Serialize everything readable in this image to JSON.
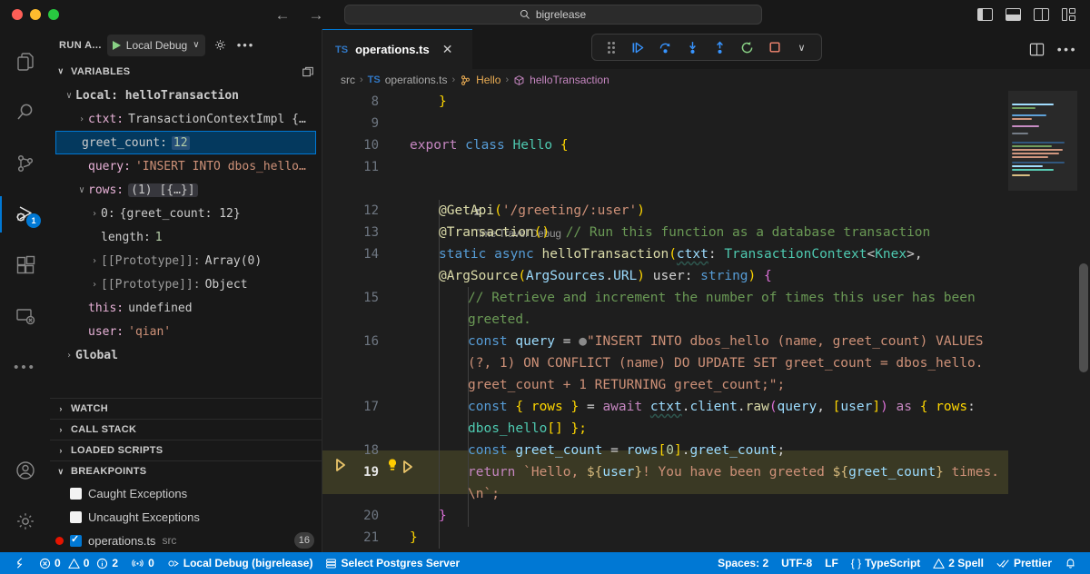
{
  "titlebar": {
    "search_value": "bigrelease",
    "search_icon": "search-icon",
    "back_icon": "←",
    "forward_icon": "→",
    "layout_icons": [
      "toggle-primary-sidebar",
      "toggle-panel",
      "toggle-secondary-sidebar",
      "customize-layout"
    ]
  },
  "activitybar": {
    "items": [
      {
        "name": "explorer",
        "icon": "files-icon",
        "active": false
      },
      {
        "name": "search",
        "icon": "search-icon",
        "active": false
      },
      {
        "name": "source-control",
        "icon": "source-control-icon",
        "active": false
      },
      {
        "name": "run-and-debug",
        "icon": "debug-icon",
        "active": true,
        "badge": "1"
      },
      {
        "name": "extensions",
        "icon": "extensions-icon",
        "active": false
      },
      {
        "name": "remote-explorer",
        "icon": "remote-icon",
        "active": false
      },
      {
        "name": "more",
        "icon": "ellipsis-icon",
        "active": false
      }
    ],
    "bottom": [
      {
        "name": "accounts",
        "icon": "account-icon"
      },
      {
        "name": "settings",
        "icon": "gear-icon"
      }
    ]
  },
  "sidebar": {
    "header": {
      "title": "RUN A...",
      "config_label": "Local Debug",
      "play_icon": "play-icon",
      "chevron_icon": "chevron-down-icon",
      "gear_icon": "gear-icon",
      "more_icon": "ellipsis-icon"
    },
    "variables": {
      "title": "VARIABLES",
      "action_icon": "split-view-icon",
      "rows": [
        {
          "indent": 0,
          "twisty": "∨",
          "name": "Local: helloTransaction",
          "value": "",
          "style": "scope"
        },
        {
          "indent": 1,
          "twisty": "›",
          "name": "ctxt:",
          "value": "TransactionContextImpl {…",
          "style": "plain"
        },
        {
          "indent": 2,
          "twisty": "",
          "name": "greet_count:",
          "value": "12",
          "style": "num",
          "selected": true
        },
        {
          "indent": 2,
          "twisty": "",
          "name": "query:",
          "value": "'INSERT INTO dbos_hello…",
          "style": "str"
        },
        {
          "indent": 1,
          "twisty": "∨",
          "name": "rows:",
          "value": "(1) [{…}]",
          "style": "chip"
        },
        {
          "indent": 2,
          "twisty": "›",
          "name": "0:",
          "value": "{greet_count: 12}",
          "style": "plain"
        },
        {
          "indent": 3,
          "twisty": "",
          "name": "length:",
          "value": "1",
          "style": "num"
        },
        {
          "indent": 2,
          "twisty": "›",
          "name": "[[Prototype]]:",
          "value": "Array(0)",
          "style": "dim"
        },
        {
          "indent": 2,
          "twisty": "›",
          "name": "[[Prototype]]:",
          "value": "Object",
          "style": "dim"
        },
        {
          "indent": 2,
          "twisty": "",
          "name": "this:",
          "value": "undefined",
          "style": "plain"
        },
        {
          "indent": 2,
          "twisty": "",
          "name": "user:",
          "value": "'qian'",
          "style": "str"
        },
        {
          "indent": 0,
          "twisty": "›",
          "name": "Global",
          "value": "",
          "style": "scope"
        }
      ]
    },
    "sections": [
      {
        "title": "WATCH",
        "twisty": "›"
      },
      {
        "title": "CALL STACK",
        "twisty": "›"
      },
      {
        "title": "LOADED SCRIPTS",
        "twisty": "›"
      }
    ],
    "breakpoints": {
      "title": "BREAKPOINTS",
      "twisty": "∨",
      "items": [
        {
          "label": "Caught Exceptions",
          "checked": false,
          "dot": false,
          "dir": "",
          "line": ""
        },
        {
          "label": "Uncaught Exceptions",
          "checked": false,
          "dot": false,
          "dir": "",
          "line": ""
        },
        {
          "label": "operations.ts",
          "checked": true,
          "dot": true,
          "dir": "src",
          "line": "16"
        }
      ]
    }
  },
  "editor": {
    "tab": {
      "label": "operations.ts",
      "icon": "typescript-icon",
      "icon_text": "TS",
      "close_icon": "close-icon"
    },
    "tab_actions": [
      {
        "name": "split-editor-right",
        "icon": "split-editor-icon"
      },
      {
        "name": "more-actions",
        "icon": "ellipsis-icon"
      }
    ],
    "debug_toolbar": {
      "grip_icon": "grip-icon",
      "buttons": [
        {
          "name": "continue",
          "icon": "continue-icon"
        },
        {
          "name": "step-over",
          "icon": "step-over-icon"
        },
        {
          "name": "step-into",
          "icon": "step-into-icon"
        },
        {
          "name": "step-out",
          "icon": "step-out-icon"
        },
        {
          "name": "restart",
          "icon": "restart-icon"
        },
        {
          "name": "stop",
          "icon": "stop-icon"
        },
        {
          "name": "more-debug-actions",
          "icon": "chevron-down-icon"
        }
      ]
    },
    "breadcrumb": [
      {
        "label": "src",
        "kind": "folder"
      },
      {
        "label": "operations.ts",
        "kind": "file",
        "icon_text": "TS"
      },
      {
        "label": "Hello",
        "kind": "class"
      },
      {
        "label": "helloTransaction",
        "kind": "method"
      }
    ],
    "codelens": {
      "label": "Time Travel Debug",
      "icon": "hourglass-icon"
    },
    "lines": [
      {
        "num": "8",
        "marker": "",
        "tokens": [
          {
            "t": "}",
            "c": "brk-y"
          }
        ],
        "indent": 2
      },
      {
        "num": "9",
        "marker": "",
        "tokens": [],
        "indent": 0
      },
      {
        "num": "10",
        "marker": "",
        "tokens": [
          {
            "t": "export ",
            "c": "kw"
          },
          {
            "t": "class ",
            "c": "kw2"
          },
          {
            "t": "Hello ",
            "c": "typ"
          },
          {
            "t": "{",
            "c": "brk-y"
          }
        ],
        "indent": 0
      },
      {
        "num": "11",
        "marker": "",
        "tokens": [],
        "indent": 0
      },
      {
        "num": "12",
        "marker": "",
        "tokens": [
          {
            "t": "@",
            "c": "dec"
          },
          {
            "t": "GetApi",
            "c": "dec"
          },
          {
            "t": "(",
            "c": "brk-y"
          },
          {
            "t": "'/greeting/:user'",
            "c": "str"
          },
          {
            "t": ")",
            "c": "brk-y"
          }
        ],
        "indent": 2
      },
      {
        "num": "13",
        "marker": "",
        "tokens": [
          {
            "t": "@Transaction",
            "c": "dec"
          },
          {
            "t": "()",
            "c": "brk-y"
          },
          {
            "t": "  // Run this function as a database transaction",
            "c": "cmt"
          }
        ],
        "indent": 2
      },
      {
        "num": "14",
        "marker": "",
        "tokens": [
          {
            "t": "static async ",
            "c": "kw2"
          },
          {
            "t": "helloTransaction",
            "c": "fn"
          },
          {
            "t": "(",
            "c": "brk-y"
          },
          {
            "t": "ctxt",
            "c": "var"
          },
          {
            "t": ": ",
            "c": "pun"
          },
          {
            "t": "TransactionContext",
            "c": "typ"
          },
          {
            "t": "<",
            "c": "pun"
          },
          {
            "t": "Knex",
            "c": "typ"
          },
          {
            "t": ">",
            "c": "pun"
          },
          {
            "t": ",",
            "c": "pun"
          }
        ],
        "indent": 2
      },
      {
        "num": "",
        "marker": "",
        "tokens": [
          {
            "t": "@ArgSource",
            "c": "dec"
          },
          {
            "t": "(",
            "c": "brk-y"
          },
          {
            "t": "ArgSources",
            "c": "var"
          },
          {
            "t": ".",
            "c": "pun"
          },
          {
            "t": "URL",
            "c": "var"
          },
          {
            "t": ")",
            "c": "brk-y"
          },
          {
            "t": " user",
            "c": "pun"
          },
          {
            "t": ": ",
            "c": "pun"
          },
          {
            "t": "string",
            "c": "kw2"
          },
          {
            "t": ")",
            "c": "brk-y"
          },
          {
            "t": " {",
            "c": "brk-p"
          }
        ],
        "indent": 2
      },
      {
        "num": "15",
        "marker": "",
        "tokens": [
          {
            "t": "// Retrieve and increment the number of times this user has been",
            "c": "cmt"
          }
        ],
        "indent": 4
      },
      {
        "num": "",
        "marker": "",
        "tokens": [
          {
            "t": "greeted.",
            "c": "cmt"
          }
        ],
        "indent": 4
      },
      {
        "num": "16",
        "marker": "breakpoint",
        "tokens": [
          {
            "t": "const ",
            "c": "kw2"
          },
          {
            "t": "query",
            "c": "var"
          },
          {
            "t": " = ",
            "c": "pun"
          },
          {
            "t": "⬤",
            "c": "inline"
          },
          {
            "t": "\"INSERT INTO dbos_hello (name, greet_count) VALUES",
            "c": "str"
          }
        ],
        "indent": 4
      },
      {
        "num": "",
        "marker": "",
        "tokens": [
          {
            "t": "(?, 1) ON CONFLICT (name) DO UPDATE SET greet_count = dbos_hello.",
            "c": "str"
          }
        ],
        "indent": 4
      },
      {
        "num": "",
        "marker": "",
        "tokens": [
          {
            "t": "greet_count + 1 RETURNING greet_count;\";",
            "c": "str"
          }
        ],
        "indent": 4
      },
      {
        "num": "17",
        "marker": "",
        "tokens": [
          {
            "t": "const ",
            "c": "kw2"
          },
          {
            "t": "{ rows }",
            "c": "brk-y"
          },
          {
            "t": " = ",
            "c": "pun"
          },
          {
            "t": "await ",
            "c": "kw"
          },
          {
            "t": "ctxt",
            "c": "var"
          },
          {
            "t": ".",
            "c": "pun"
          },
          {
            "t": "client",
            "c": "var"
          },
          {
            "t": ".",
            "c": "pun"
          },
          {
            "t": "raw",
            "c": "fn"
          },
          {
            "t": "(",
            "c": "brk-p"
          },
          {
            "t": "query",
            "c": "var"
          },
          {
            "t": ", ",
            "c": "pun"
          },
          {
            "t": "[",
            "c": "brk-y"
          },
          {
            "t": "user",
            "c": "var"
          },
          {
            "t": "]",
            "c": "brk-y"
          },
          {
            "t": ")",
            "c": "brk-p"
          },
          {
            "t": " as ",
            "c": "kw"
          },
          {
            "t": "{ rows",
            "c": "brk-y"
          },
          {
            "t": ":",
            "c": "pun"
          }
        ],
        "indent": 4
      },
      {
        "num": "",
        "marker": "",
        "tokens": [
          {
            "t": "dbos_hello",
            "c": "typ"
          },
          {
            "t": "[]",
            "c": "brk-y"
          },
          {
            "t": " };",
            "c": "brk-y"
          }
        ],
        "indent": 4
      },
      {
        "num": "18",
        "marker": "",
        "tokens": [
          {
            "t": "const ",
            "c": "kw2"
          },
          {
            "t": "greet_count",
            "c": "var"
          },
          {
            "t": " = ",
            "c": "pun"
          },
          {
            "t": "rows",
            "c": "var"
          },
          {
            "t": "[",
            "c": "brk-y"
          },
          {
            "t": "0",
            "c": "num"
          },
          {
            "t": "]",
            "c": "brk-y"
          },
          {
            "t": ".",
            "c": "pun"
          },
          {
            "t": "greet_count",
            "c": "var"
          },
          {
            "t": ";",
            "c": "pun"
          }
        ],
        "indent": 4
      },
      {
        "num": "19",
        "marker": "current",
        "tokens": [
          {
            "t": "return ",
            "c": "kw"
          },
          {
            "t": "`Hello, ",
            "c": "str"
          },
          {
            "t": "${",
            "c": "yel"
          },
          {
            "t": "user",
            "c": "var"
          },
          {
            "t": "}",
            "c": "yel"
          },
          {
            "t": "! You have been greeted ",
            "c": "str"
          },
          {
            "t": "${",
            "c": "yel"
          },
          {
            "t": "greet_count",
            "c": "var"
          },
          {
            "t": "}",
            "c": "yel"
          },
          {
            "t": " times.",
            "c": "str"
          }
        ],
        "indent": 4,
        "highlight": true
      },
      {
        "num": "",
        "marker": "",
        "tokens": [
          {
            "t": "\\n`;",
            "c": "str"
          }
        ],
        "indent": 4,
        "highlight": true
      },
      {
        "num": "20",
        "marker": "",
        "tokens": [
          {
            "t": "}",
            "c": "brk-p"
          }
        ],
        "indent": 2
      },
      {
        "num": "21",
        "marker": "",
        "tokens": [
          {
            "t": "}",
            "c": "brk-y"
          }
        ],
        "indent": 0
      }
    ]
  },
  "statusbar": {
    "left": [
      {
        "name": "remote-indicator",
        "icon": "remote-icon",
        "label": ""
      },
      {
        "name": "problems",
        "icon": "error-icon",
        "label": "0",
        "icon2": "warning-icon",
        "label2": "0",
        "icon3": "info-icon",
        "label3": "2"
      },
      {
        "name": "ports",
        "icon": "radio-tower-icon",
        "label": "0"
      },
      {
        "name": "debug-session",
        "icon": "debug-alt-icon",
        "label": "Local Debug (bigrelease)"
      },
      {
        "name": "postgres-server",
        "icon": "database-icon",
        "label": "Select Postgres Server"
      }
    ],
    "right": [
      {
        "name": "indentation",
        "label": "Spaces: 2"
      },
      {
        "name": "encoding",
        "label": "UTF-8"
      },
      {
        "name": "eol",
        "label": "LF"
      },
      {
        "name": "language-mode",
        "label": "TypeScript",
        "icon": "braces-icon"
      },
      {
        "name": "spell-check",
        "label": "2 Spell",
        "icon": "warning-icon"
      },
      {
        "name": "prettier",
        "label": "Prettier",
        "icon": "check-all-icon"
      },
      {
        "name": "notifications",
        "label": "",
        "icon": "bell-icon"
      }
    ]
  }
}
